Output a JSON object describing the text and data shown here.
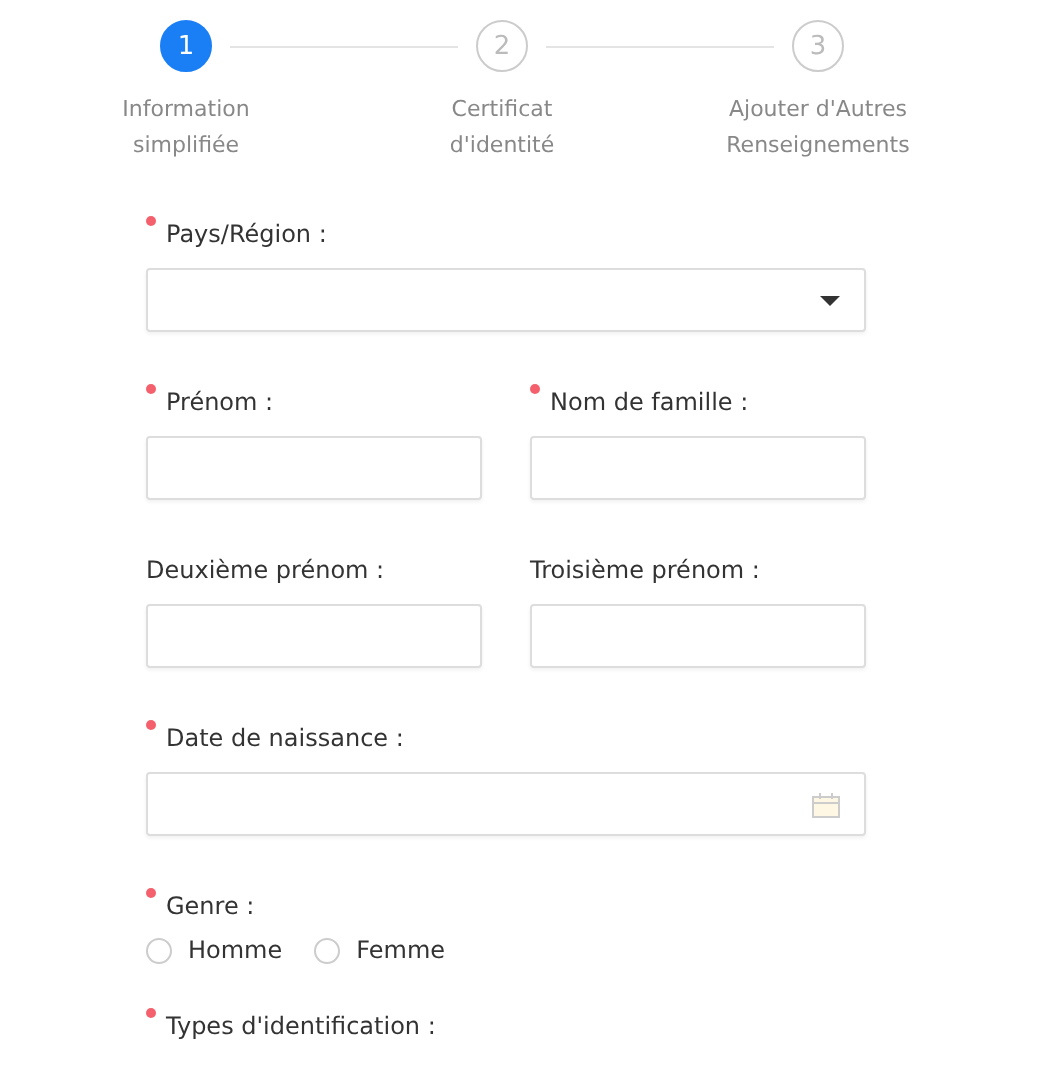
{
  "steps": [
    {
      "number": "1",
      "lines": [
        "Information",
        "simplifiée"
      ],
      "selected": true
    },
    {
      "number": "2",
      "lines": [
        "Certificat",
        "d'identité"
      ],
      "selected": false
    },
    {
      "number": "3",
      "lines": [
        "Ajouter d'Autres",
        "Renseignements"
      ],
      "selected": false
    }
  ],
  "rows": [
    {
      "kind": "select",
      "fields": [
        {
          "label": "Pays/Région :",
          "required": true
        }
      ]
    },
    {
      "kind": "text",
      "fields": [
        {
          "label": "Prénom :",
          "required": true
        },
        {
          "label": "Nom de famille :",
          "required": true
        }
      ]
    },
    {
      "kind": "text",
      "fields": [
        {
          "label": "Deuxième prénom :",
          "required": false
        },
        {
          "label": "Troisième prénom :",
          "required": false
        }
      ]
    },
    {
      "kind": "date",
      "fields": [
        {
          "label": "Date de naissance :",
          "required": true
        }
      ]
    },
    {
      "kind": "radio",
      "fields": [
        {
          "label": "Genre :",
          "required": true,
          "options": [
            {
              "label": "Homme",
              "selected": false
            },
            {
              "label": "Femme",
              "selected": false
            }
          ]
        }
      ]
    },
    {
      "kind": "label",
      "fields": [
        {
          "label": "Types d'identification :",
          "required": true
        }
      ]
    }
  ]
}
